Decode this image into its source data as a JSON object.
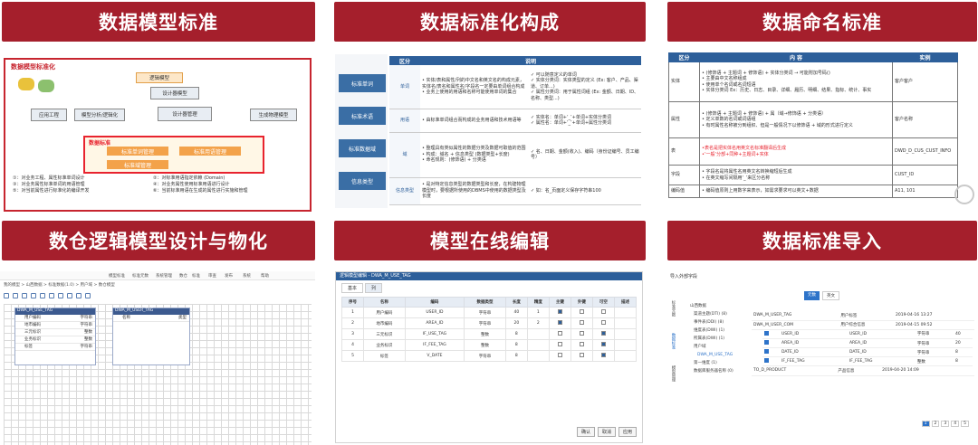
{
  "banners": {
    "b1": "数据模型标准",
    "b2": "数据标准化构成",
    "b3": "数据命名标准",
    "b4": "数仓逻辑模型设计与物化",
    "b5": "模型在线编辑",
    "b6": "数据标准导入"
  },
  "panel1": {
    "title": "数据模型标准化",
    "boxes": [
      "应用工程",
      "模型分析/逻辑化",
      "逻辑模型",
      "设计器模型",
      "设计器管理",
      "生成物理模型",
      "数据标准"
    ],
    "standards": [
      "标准单词管理",
      "标准用语管理",
      "标准域管理"
    ],
    "footnotes": [
      "①：对业务工程、属性标准单词设计",
      "②：对标准用语指定依赖 (Domain)",
      "③：对业务属性标准单词的用语管理",
      "④：对业务属性使用标准用语进行设计",
      "⑤：对当前属性进行标准化的编译开发",
      "⑥：当前标准用语在生成的属性进行实施和管理"
    ]
  },
  "panel2": {
    "side": [
      "标准单词",
      "标准术语",
      "标准数据域",
      "信息类型"
    ],
    "headers": [
      "区分",
      "说明"
    ],
    "rows": [
      {
        "cat": "单词",
        "desc": "• 实体/表和属性/列的中文名和英文名的构成元素，实体名/表名和属性名/字段名一定要由单词组合构成\n• 业务上使用的用语和名称可能使用单词的集合",
        "note": "✓ 可以随意定义的单词\n✓ 实体分类词：实体类型的定义 (Ex: 客户、产品、渠道、订单...)\n✓ 属性分类词：用于属性词组 (Ex: 金额、日期、ID、名称、类型...)"
      },
      {
        "cat": "用语",
        "desc": "• 由标准单词组合而构成的业务用语和技术用语等",
        "note": "✓ 实体名：单词+‘_’+单词+实体分类词\n✓ 属性名：单词+‘_’+单词+属性分类词"
      },
      {
        "cat": "域",
        "desc": "• 整理具有类似属性的数据分类及数据可取值的范围\n• 构成：域名 + 信息类型 (数据类型+长度)\n• 命名规则：(修饰语) + 分类语",
        "note": "✓ 名、日期、金额(收入)、编码（身份证编号、员工编号）"
      },
      {
        "cat": "信息类型",
        "desc": "• 是对特定信息类型的数据类型和长度，在构建物理模型时，要根据所使用的DBMS中使用的数据类型及长度",
        "note": "✓ 如：名_页面定义保存字符串100"
      }
    ]
  },
  "panel3": {
    "headers": [
      "区分",
      "内  容",
      "实例"
    ],
    "rows": [
      {
        "cat": "实体",
        "content": "• (修饰语 + 主题词 + 修饰语) + 实体分类词 → 可能附加号码()\n• 主要由中文名称组成\n• 使用单个名词或名词短语\n• 实体分类词 Ex：历史、日志、目录、详细、履历、明细、结果、指标、统计、事实",
        "example": "客户客户"
      },
      {
        "cat": "属性",
        "content": "• (修饰语 + 主题词 + 修饰语) + 属（域→修饰语 + 分类语）\n• 定义单数的名词或词语组\n• 有时属性名称被分到组织、但是一般情况下以修饰语 + 域的形式进行定义",
        "example": "客户名称"
      },
      {
        "cat": "表",
        "content": "•表名是把实体名用英文名标准翻译后生成\n•‘一般’分部+同种+主题词+实体",
        "example": "DWD_D_CUS_CUST_INFO",
        "red": "‘一般’分部+同种+主题词+实体"
      },
      {
        "cat": "字段",
        "content": "• 字段名是将属性名用英文名转换缩短后生成\n• 在英文缩写间隔用‘_’来区分名称",
        "example": "CUST_ID"
      },
      {
        "cat": "编码值",
        "content": "• 编码值原则上用数字来表示，如需求要求可以英文+数据",
        "example": "A11, 101"
      }
    ]
  },
  "panel4": {
    "menu": [
      "模型标准",
      "标准元数",
      "系统管理",
      "数仓",
      "标准",
      "审查",
      "发布",
      "系统",
      "帮助"
    ],
    "breadcrumb": "我的模型 > 山西数据 > 标准数据(1.0) > 用户域 > 数仓模型",
    "entity1": {
      "title": "DWA_M_USE_TAG",
      "rows": [
        "用户编码",
        "地市编码",
        "三元标识",
        "业务标识",
        "标签"
      ],
      "types": [
        "字符串",
        "字符串",
        "整数",
        "整数",
        "字符串"
      ]
    },
    "entity2": {
      "title": "DWA_M_USER_TAG",
      "cols": [
        "名称",
        "类型"
      ]
    }
  },
  "panel5": {
    "title": "逻辑模型编辑 - DWA_M_USE_TAG",
    "tabs": [
      "基本",
      "列"
    ],
    "headers": [
      "序号",
      "名称",
      "编码",
      "数据类型",
      "长度",
      "精度",
      "主键",
      "外键",
      "可空",
      "描述"
    ],
    "rows": [
      [
        "1",
        "用户编码",
        "USER_ID",
        "字符串",
        "40",
        "1"
      ],
      [
        "2",
        "地市编码",
        "AREA_ID",
        "字符串",
        "20",
        "2"
      ],
      [
        "3",
        "三元标识",
        "IF_USE_TAG",
        "整数",
        "8",
        ""
      ],
      [
        "4",
        "业务标识",
        "IF_FEE_TAG",
        "整数",
        "8",
        ""
      ],
      [
        "5",
        "标签",
        "V_DATE",
        "字符串",
        "8",
        ""
      ]
    ],
    "buttons": [
      "确认",
      "取消",
      "应用"
    ]
  },
  "panel6": {
    "header": "导入外部字段",
    "side": [
      "标准元数",
      "数据标准",
      "模型管理"
    ],
    "tabs": [
      "元数",
      "英文"
    ],
    "tree": [
      "山西数据",
      "渠道主题(DTI) (8)",
      "事件表(DDI) (8)",
      "维度表(DWI) (1)",
      "所属表(DWI) (1)",
      "用户域",
      "DWA_M_USE_TAG",
      "第一维度 (1)",
      "数据库服务器名称 (0)"
    ],
    "tables": [
      {
        "name": "DWA_M_USER_TAG",
        "desc": "用户标签",
        "date": "2019-04-16 13:27"
      },
      {
        "name": "DWA_M_USER_COM",
        "desc": "用户综合信息",
        "date": "2019-04-15 09:52"
      }
    ],
    "columns": [
      [
        "USER_ID",
        "USER_ID",
        "字符串",
        "40"
      ],
      [
        "AREA_ID",
        "AREA_ID",
        "字符串",
        "20"
      ],
      [
        "DATE_ID",
        "DATE_ID",
        "字符串",
        "8"
      ],
      [
        "IF_FEE_TAG",
        "IF_FEE_TAG",
        "整数",
        "8"
      ]
    ],
    "extra": {
      "name": "TO_D_PRODUCT",
      "desc": "产品信息",
      "date": "2019-04-20 14:09"
    },
    "pager": [
      "1",
      "2",
      "3",
      "4",
      "5"
    ]
  }
}
